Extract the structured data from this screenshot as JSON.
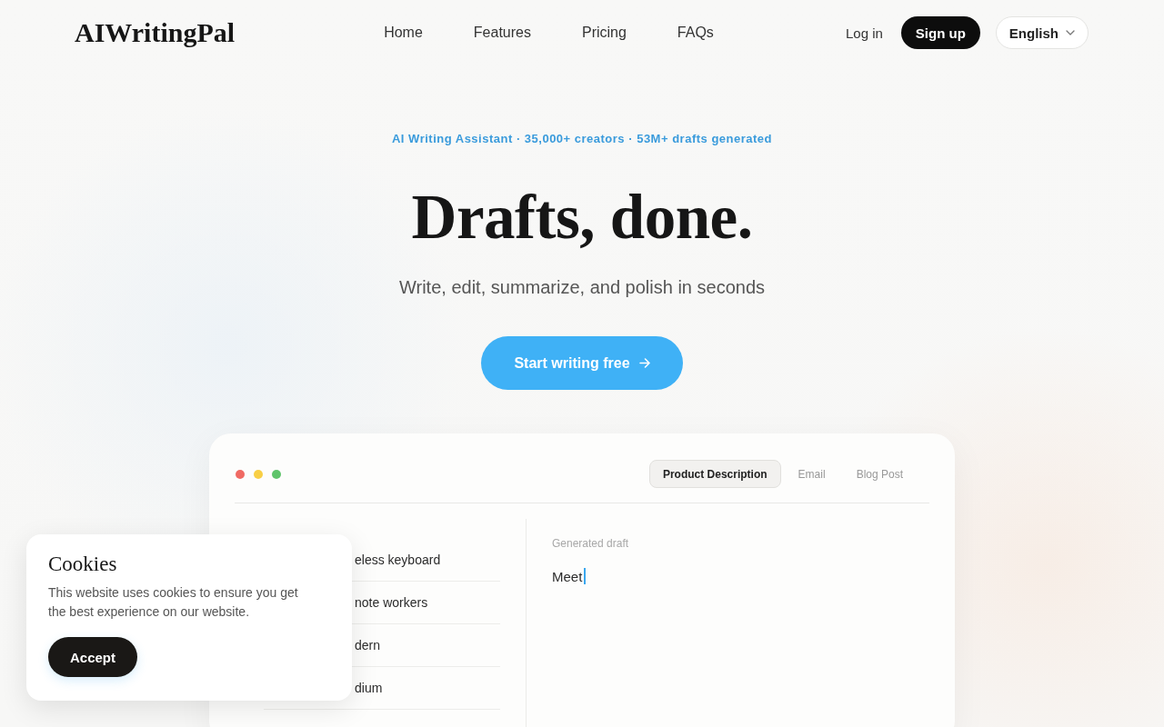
{
  "nav": {
    "logo": "AIWritingPal",
    "links": [
      "Home",
      "Features",
      "Pricing",
      "FAQs"
    ],
    "login": "Log in",
    "signup": "Sign up",
    "language": "English"
  },
  "hero": {
    "tagline": "AI Writing Assistant · 35,000+ creators · 53M+ drafts generated",
    "title": "Drafts, done.",
    "subtitle": "Write, edit, summarize, and polish in seconds",
    "cta": "Start writing free"
  },
  "demo": {
    "tabs": [
      {
        "label": "Product Description",
        "selected": true
      },
      {
        "label": "Email",
        "selected": false
      },
      {
        "label": "Blog Post",
        "selected": false
      }
    ],
    "inputs": [
      "eless keyboard",
      "note workers",
      "dern",
      "dium"
    ],
    "output_label": "Generated draft",
    "output_text": "Meet"
  },
  "cookie_banner": {
    "title": "Cookies",
    "text": "This website uses cookies to ensure you get the best experience on our website.",
    "button": "Accept"
  }
}
